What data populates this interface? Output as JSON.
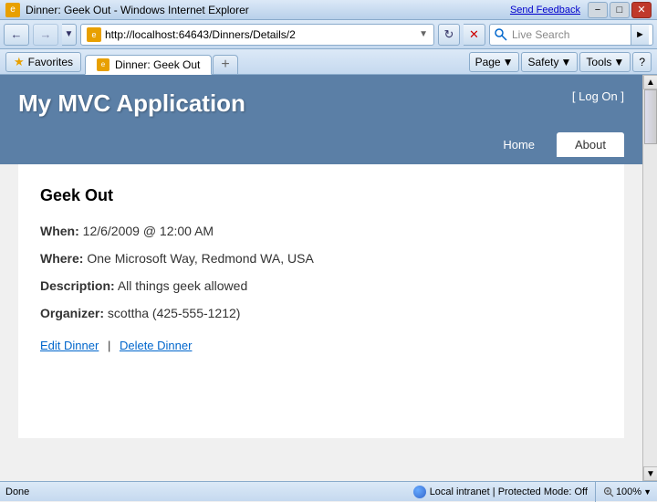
{
  "titlebar": {
    "title": "Dinner: Geek Out - Windows Internet Explorer",
    "send_feedback": "Send Feedback"
  },
  "addrbar": {
    "url": "http://localhost:64643/Dinners/Details/2",
    "search_placeholder": "Live Search"
  },
  "favbar": {
    "favorites_label": "Favorites",
    "tab_label": "Dinner: Geek Out"
  },
  "toolbar": {
    "page_label": "Page",
    "safety_label": "Safety",
    "tools_label": "Tools"
  },
  "app": {
    "title": "My MVC Application",
    "login_text": "[ Log On ]",
    "nav": {
      "home_label": "Home",
      "about_label": "About"
    },
    "dinner": {
      "title": "Geek Out",
      "when_label": "When:",
      "when_value": "12/6/2009 @ 12:00 AM",
      "where_label": "Where:",
      "where_value": "One Microsoft Way, Redmond WA, USA",
      "description_label": "Description:",
      "description_value": "All things geek allowed",
      "organizer_label": "Organizer:",
      "organizer_value": "scottha (425-555-1212)",
      "edit_link": "Edit Dinner",
      "delete_link": "Delete Dinner",
      "link_separator": "|"
    }
  },
  "statusbar": {
    "status": "Done",
    "intranet": "Local intranet | Protected Mode: Off",
    "zoom": "100%"
  }
}
